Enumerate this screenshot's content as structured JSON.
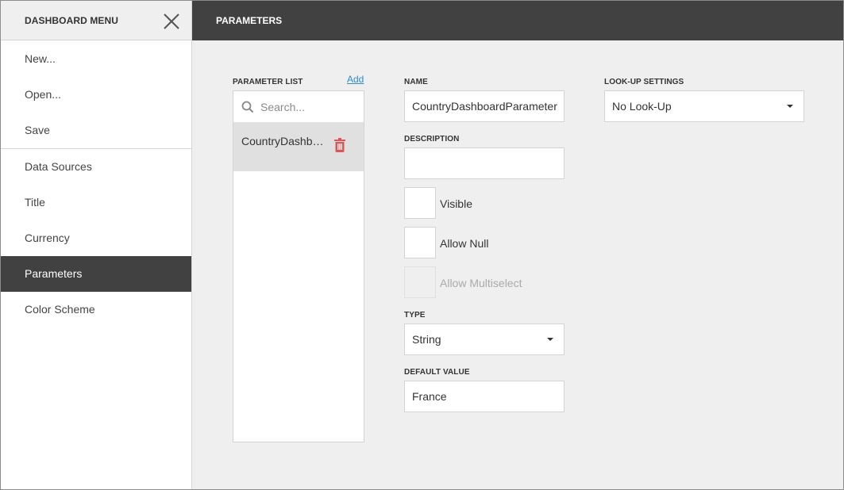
{
  "sidebar": {
    "title": "DASHBOARD MENU",
    "close_icon": "close-icon",
    "groups": [
      {
        "items": [
          {
            "label": "New..."
          },
          {
            "label": "Open..."
          },
          {
            "label": "Save"
          }
        ]
      },
      {
        "items": [
          {
            "label": "Data Sources"
          },
          {
            "label": "Title"
          },
          {
            "label": "Currency"
          },
          {
            "label": "Parameters",
            "active": true
          },
          {
            "label": "Color Scheme"
          }
        ]
      }
    ]
  },
  "main": {
    "title": "PARAMETERS",
    "parameter_list": {
      "label": "PARAMETER LIST",
      "add_label": "Add",
      "search_placeholder": "Search...",
      "items": [
        {
          "label": "CountryDashboardParameter",
          "delete_icon": "trash-icon"
        }
      ]
    },
    "name": {
      "label": "NAME",
      "value": "CountryDashboardParameter"
    },
    "description": {
      "label": "DESCRIPTION",
      "value": ""
    },
    "checkboxes": {
      "visible": {
        "label": "Visible",
        "checked": false
      },
      "allow_null": {
        "label": "Allow Null",
        "checked": false
      },
      "allow_multiselect": {
        "label": "Allow Multiselect",
        "checked": false,
        "disabled": true
      }
    },
    "type": {
      "label": "TYPE",
      "value": "String"
    },
    "default_value": {
      "label": "DEFAULT VALUE",
      "value": "France"
    },
    "lookup": {
      "label": "LOOK-UP SETTINGS",
      "value": "No Look-Up"
    }
  },
  "colors": {
    "header_dark": "#414141",
    "panel_bg": "#efefef",
    "link": "#2d8ad3",
    "delete": "#e25454"
  }
}
